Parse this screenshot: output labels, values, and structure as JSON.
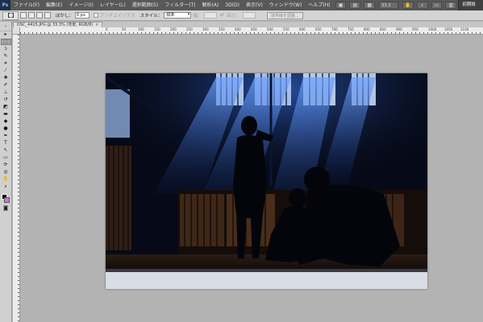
{
  "app": {
    "logo": "Ps"
  },
  "menu": [
    "ファイル(F)",
    "編集(E)",
    "イメージ(I)",
    "レイヤー(L)",
    "選択範囲(S)",
    "フィルター(T)",
    "解析(A)",
    "3D(D)",
    "表示(V)",
    "ウィンドウ(W)",
    "ヘルプ(H)"
  ],
  "menu_right": {
    "zoom": "33.3",
    "workspace": "初期設定"
  },
  "options": {
    "feather_label": "ぼかし：",
    "feather_value": "0 px",
    "antialias_label": "アンチエイリアス",
    "style_label": "スタイル：",
    "style_value": "標準",
    "width_label": "幅：",
    "height_label": "高さ：",
    "refine_edge_label": "境界線を調整..."
  },
  "document": {
    "tab_title": "DSC_4415.JPG @ 33.3% (背景, RGB/8)",
    "close_glyph": "×"
  },
  "ruler": {
    "ticks": [
      "0",
      "50",
      "100",
      "150",
      "200",
      "250",
      "300",
      "350",
      "400",
      "450",
      "500",
      "550",
      "600",
      "650",
      "700",
      "750",
      "800",
      "850",
      "900",
      "950",
      "1000",
      "1050",
      "1100"
    ]
  },
  "colors": {
    "foreground": "#000000",
    "background": "#c27bd9",
    "menubar": "#585858",
    "pasteboard": "#b3b3b3"
  },
  "tools": [
    "move-tool-icon",
    "marquee-tool-icon",
    "lasso-tool-icon",
    "quick-select-tool-icon",
    "crop-tool-icon",
    "eyedropper-tool-icon",
    "healing-brush-tool-icon",
    "brush-tool-icon",
    "clone-stamp-tool-icon",
    "history-brush-tool-icon",
    "eraser-tool-icon",
    "gradient-tool-icon",
    "blur-tool-icon",
    "dodge-tool-icon",
    "pen-tool-icon",
    "type-tool-icon",
    "path-select-tool-icon",
    "shape-tool-icon",
    "3d-rotate-tool-icon",
    "3d-orbit-tool-icon",
    "hand-tool-icon",
    "zoom-tool-icon"
  ]
}
